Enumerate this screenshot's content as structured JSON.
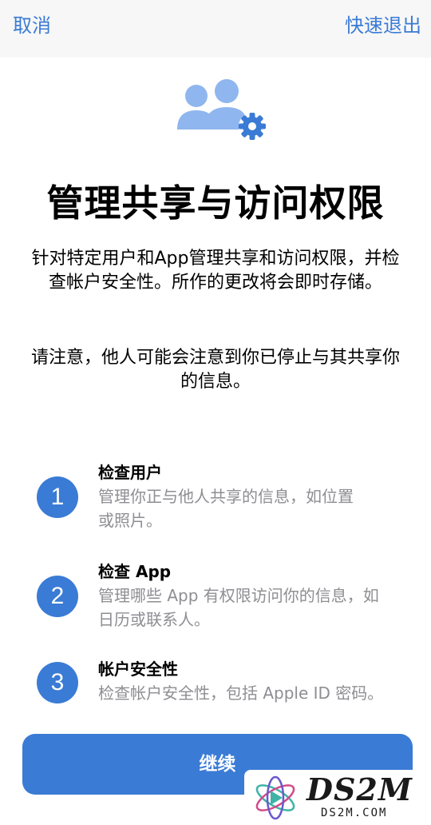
{
  "nav": {
    "cancel_label": "取消",
    "exit_label": "快速退出"
  },
  "hero": {
    "icon": "people-gear-icon"
  },
  "title": "管理共享与访问权限",
  "description": "针对特定用户和App管理共享和访问权限，并检查帐户安全性。所作的更改将会即时存储。",
  "notice": "请注意，他人可能会注意到你已停止与其共享你的信息。",
  "steps": [
    {
      "number": "1",
      "title": "检查用户",
      "desc_lines": [
        "管理你正与他人共享的信息，如位置",
        "或照片。"
      ]
    },
    {
      "number": "2",
      "title": "检查 App",
      "desc_lines": [
        "管理哪些 App 有权限访问你的信息，如",
        "日历或联系人。"
      ]
    },
    {
      "number": "3",
      "title": "帐户安全性",
      "desc_lines": [
        "检查帐户安全性，包括 Apple ID 密码。"
      ]
    }
  ],
  "continue_label": "继续",
  "watermark": {
    "brand": "DS2M",
    "sub": "DS2M.COM"
  },
  "colors": {
    "accent": "#3a7bd5",
    "icon_light": "#8fb6ee",
    "secondary_text": "#8e8e93"
  }
}
